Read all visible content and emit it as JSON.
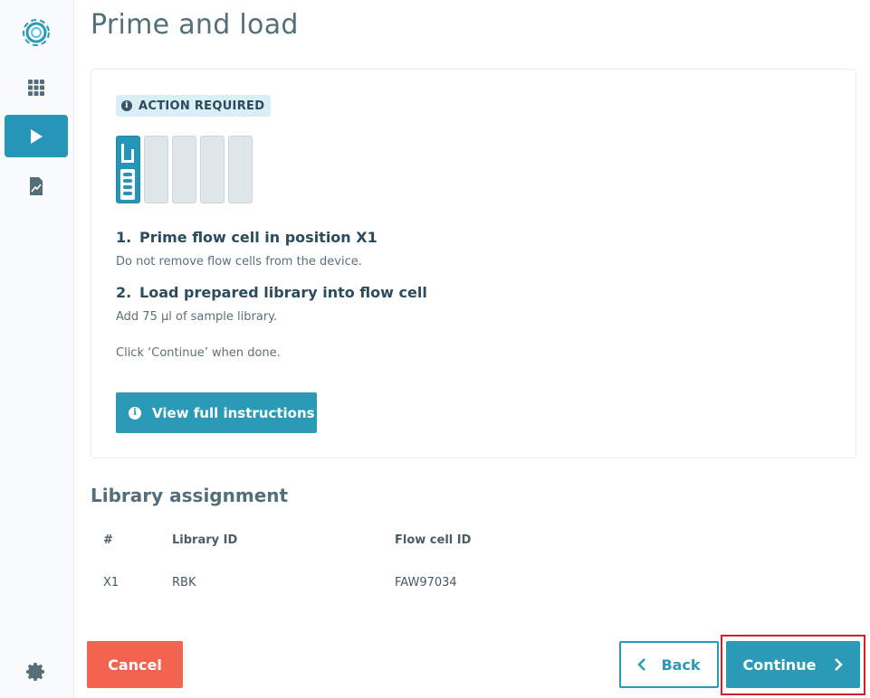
{
  "page": {
    "title": "Prime and load"
  },
  "sidebar": {
    "items": [
      {
        "name": "apps",
        "icon": "grid-icon"
      },
      {
        "name": "run",
        "icon": "play-icon",
        "active": true
      },
      {
        "name": "reports",
        "icon": "report-icon"
      },
      {
        "name": "settings",
        "icon": "gear-icon"
      }
    ],
    "accent_color": "#2596b8"
  },
  "action_card": {
    "badge_label": "ACTION REQUIRED",
    "flow_cell_slots": 5,
    "active_slot": 1,
    "steps": [
      {
        "number": "1.",
        "title": "Prime flow cell in position X1",
        "description": "Do not remove flow cells from the device."
      },
      {
        "number": "2.",
        "title": "Load prepared library into flow cell",
        "description": "Add 75 µl of sample library."
      }
    ],
    "done_text": "Click ‘Continue’ when done.",
    "instructions_button": "View full instructions"
  },
  "library_assignment": {
    "title": "Library assignment",
    "columns": [
      "#",
      "Library ID",
      "Flow cell ID"
    ],
    "rows": [
      [
        "X1",
        "RBK",
        "FAW97034"
      ]
    ]
  },
  "footer": {
    "cancel_label": "Cancel",
    "back_label": "Back",
    "continue_label": "Continue"
  },
  "colors": {
    "primary": "#2a9ab6",
    "cancel": "#f26450",
    "highlight": "#d21f2b"
  }
}
